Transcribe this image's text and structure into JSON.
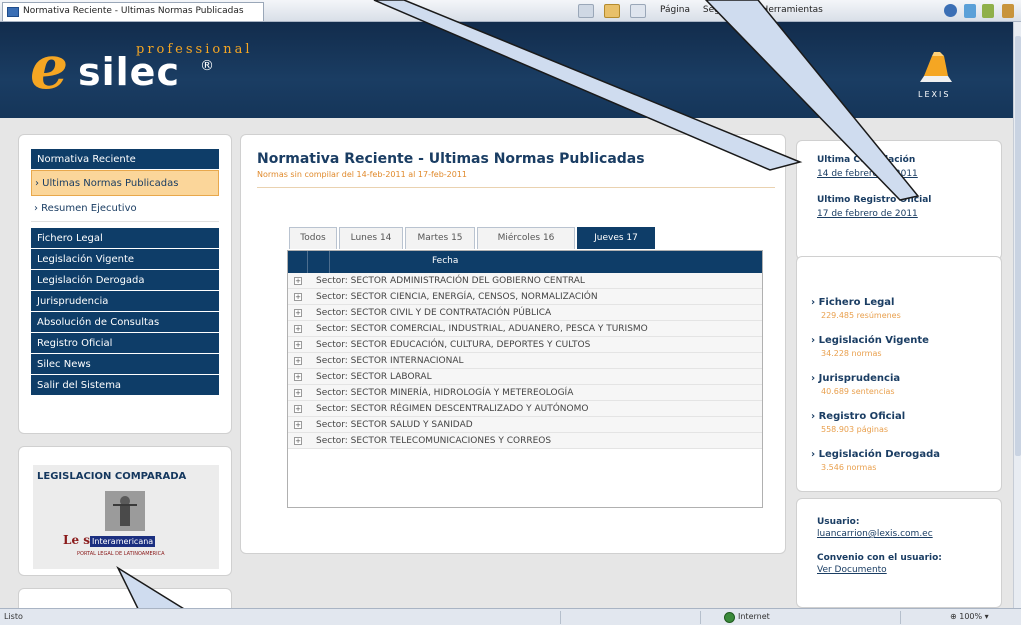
{
  "browser": {
    "tab_title": "Normativa Reciente - Ultimas Normas Publicadas",
    "commands": [
      "Página",
      "Seguridad",
      "Herramientas"
    ]
  },
  "header": {
    "logo_letter": "e",
    "logo_name": "silec",
    "logo_reg": "®",
    "logo_tagline": "professional",
    "partner": "LEXIS"
  },
  "nav": {
    "items": [
      {
        "label": "Normativa Reciente",
        "type": "dark"
      },
      {
        "label": "› Ultimas Normas Publicadas",
        "type": "sub-active"
      },
      {
        "label": "› Resumen Ejecutivo",
        "type": "sub"
      },
      {
        "label": "Fichero Legal",
        "type": "dark"
      },
      {
        "label": "Legislación Vigente",
        "type": "dark"
      },
      {
        "label": "Legislación Derogada",
        "type": "dark"
      },
      {
        "label": "Jurisprudencia",
        "type": "dark"
      },
      {
        "label": "Absolución de Consultas",
        "type": "dark"
      },
      {
        "label": "Registro Oficial",
        "type": "dark"
      },
      {
        "label": "Silec News",
        "type": "dark"
      },
      {
        "label": "Salir del Sistema",
        "type": "dark"
      }
    ]
  },
  "legislacion": {
    "title": "LEGISLACION COMPARADA",
    "brand_a": "Le s",
    "brand_b": "Interamericana",
    "brand_sub": "PORTAL LEGAL DE LATINOAMERICA"
  },
  "main": {
    "title": "Normativa Reciente - Ultimas Normas Publicadas",
    "subtitle": "Normas sin compilar del 14-feb-2011 al 17-feb-2011",
    "tabs": [
      "Todos",
      "Lunes 14",
      "Martes 15",
      "Miércoles 16",
      "Jueves 17"
    ],
    "active_tab": 4,
    "grid_header": "Fecha",
    "rows": [
      "Sector: SECTOR ADMINISTRACIÓN DEL GOBIERNO CENTRAL",
      "Sector: SECTOR CIENCIA, ENERGÍA, CENSOS, NORMALIZACIÓN",
      "Sector: SECTOR CIVIL Y DE CONTRATACIÓN PÚBLICA",
      "Sector: SECTOR COMERCIAL, INDUSTRIAL, ADUANERO, PESCA Y TURISMO",
      "Sector: SECTOR EDUCACIÓN, CULTURA, DEPORTES Y CULTOS",
      "Sector: SECTOR INTERNACIONAL",
      "Sector: SECTOR LABORAL",
      "Sector: SECTOR MINERÍA, HIDROLOGÍA Y METEREOLOGÍA",
      "Sector: SECTOR RÉGIMEN DESCENTRALIZADO Y AUTÓNOMO",
      "Sector: SECTOR SALUD Y SANIDAD",
      "Sector: SECTOR TELECOMUNICACIONES Y CORREOS"
    ]
  },
  "right": {
    "ultima_compilacion_label": "Ultima Compilación",
    "ultima_compilacion_date": "14 de febrero de 2011",
    "ultimo_registro_label": "Ultimo Registro Oficial",
    "ultimo_registro_date": "17 de febrero de 2011",
    "stats": [
      {
        "title": "› Fichero Legal",
        "sub": "229.485 resúmenes"
      },
      {
        "title": "› Legislación Vigente",
        "sub": "34.228 normas"
      },
      {
        "title": "› Jurisprudencia",
        "sub": "40.689 sentencias"
      },
      {
        "title": "› Registro Oficial",
        "sub": "558.903 páginas"
      },
      {
        "title": "› Legislación Derogada",
        "sub": "3.546 normas"
      }
    ],
    "usuario_label": "Usuario:",
    "usuario_email": "luancarrion@lexis.com.ec",
    "convenio_label": "Convenio con el usuario:",
    "convenio_link": "Ver Documento"
  },
  "status": {
    "left": "Listo",
    "zone": "Internet",
    "zoom": "100%"
  },
  "colors": {
    "header_navy": "#122c4c",
    "nav_navy": "#0e3d68",
    "accent_orange": "#f5a623",
    "active_item_bg": "#fbd69a"
  }
}
